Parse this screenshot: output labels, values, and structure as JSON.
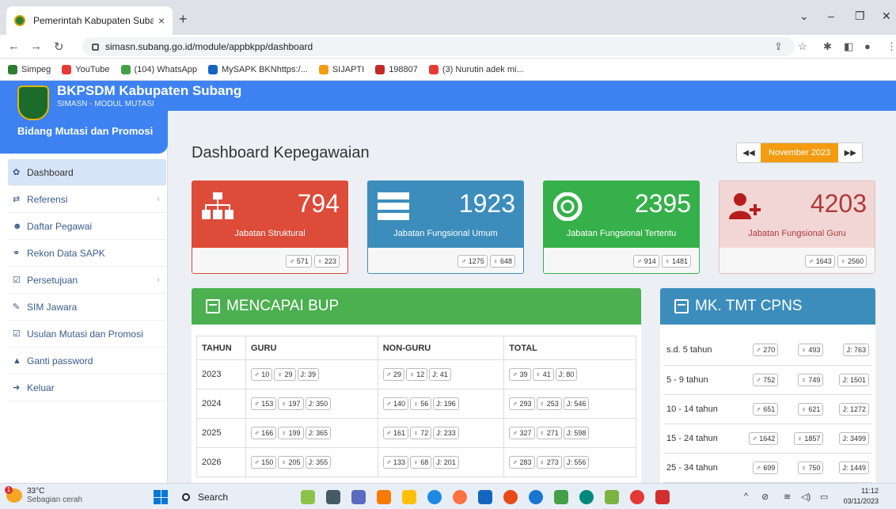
{
  "browser": {
    "tab_title": "Pemerintah Kabupaten Subang - ",
    "tab_close": "×",
    "new_tab": "+",
    "url": "simasn.subang.go.id/module/appbkpp/dashboard",
    "bookmarks": [
      {
        "label": "Simpeg",
        "color": "#2e7d32"
      },
      {
        "label": "YouTube",
        "color": "#e53935"
      },
      {
        "label": "(104) WhatsApp",
        "color": "#43a047"
      },
      {
        "label": "MySAPK BKNhttps:/...",
        "color": "#1565c0"
      },
      {
        "label": "SIJAPTI",
        "color": "#f39c12"
      },
      {
        "label": "198807",
        "color": "#c62828"
      },
      {
        "label": "(3) Nurutin adek mi...",
        "color": "#e53935"
      }
    ]
  },
  "app": {
    "brand_title": "BKPSDM Kabupaten Subang",
    "brand_subtitle": "SIMASN - MODUL MUTASI",
    "division": "Bidang Mutasi dan Promosi",
    "menu": [
      {
        "label": "Dashboard",
        "icon": "dashboard-icon",
        "glyph": "✿"
      },
      {
        "label": "Referensi",
        "icon": "exchange-icon",
        "glyph": "⇄"
      },
      {
        "label": "Daftar Pegawai",
        "icon": "users-icon",
        "glyph": "☻"
      },
      {
        "label": "Rekon Data SAPK",
        "icon": "link-icon",
        "glyph": "⚭"
      },
      {
        "label": "Persetujuan",
        "icon": "check-square-icon",
        "glyph": "☑"
      },
      {
        "label": "SIM Jawara",
        "icon": "wrench-icon",
        "glyph": "✎"
      },
      {
        "label": "Usulan Mutasi dan Promosi",
        "icon": "check-square-icon",
        "glyph": "☑"
      },
      {
        "label": "Ganti password",
        "icon": "lock-icon",
        "glyph": "▲"
      },
      {
        "label": "Keluar",
        "icon": "sign-out-icon",
        "glyph": "➜"
      }
    ],
    "page_title": "Dashboard Kepegawaian",
    "month": "November 2023",
    "prev": "◀◀",
    "next": "▶▶",
    "cards": [
      {
        "value": "794",
        "label": "Jabatan Struktural",
        "male": "♂ 571",
        "female": "♀ 223",
        "color": "#dd4b39",
        "icon": "sitemap-icon"
      },
      {
        "value": "1923",
        "label": "Jabatan Fungsional Umum",
        "male": "♂ 1275",
        "female": "♀ 648",
        "color": "#3c8dbc",
        "icon": "server-icon"
      },
      {
        "value": "2395",
        "label": "Jabatan Fungsional Tertentu",
        "male": "♂ 914",
        "female": "♀ 1481",
        "color": "#36b04a",
        "icon": "life-ring-icon"
      },
      {
        "value": "4203",
        "label": "Jabatan Fungsional Guru",
        "male": "♂ 1643",
        "female": "♀ 2560",
        "color": "#f2d6d6",
        "icon": "user-plus-icon"
      }
    ],
    "bup": {
      "title": "MENCAPAI BUP",
      "headers": [
        "TAHUN",
        "GURU",
        "NON-GURU",
        "TOTAL"
      ],
      "rows": [
        {
          "year": "2023",
          "guru": [
            "♂ 10",
            "♀ 29",
            "J: 39"
          ],
          "non": [
            "♂ 29",
            "♀ 12",
            "J: 41"
          ],
          "total": [
            "♂ 39",
            "♀ 41",
            "J: 80"
          ]
        },
        {
          "year": "2024",
          "guru": [
            "♂ 153",
            "♀ 197",
            "J: 350"
          ],
          "non": [
            "♂ 140",
            "♀ 56",
            "J: 196"
          ],
          "total": [
            "♂ 293",
            "♀ 253",
            "J: 546"
          ]
        },
        {
          "year": "2025",
          "guru": [
            "♂ 166",
            "♀ 199",
            "J: 365"
          ],
          "non": [
            "♂ 161",
            "♀ 72",
            "J: 233"
          ],
          "total": [
            "♂ 327",
            "♀ 271",
            "J: 598"
          ]
        },
        {
          "year": "2026",
          "guru": [
            "♂ 150",
            "♀ 205",
            "J: 355"
          ],
          "non": [
            "♂ 133",
            "♀ 68",
            "J: 201"
          ],
          "total": [
            "♂ 283",
            "♀ 273",
            "J: 556"
          ]
        }
      ]
    },
    "mk": {
      "title": "MK. TMT CPNS",
      "rows": [
        {
          "label": "s.d. 5 tahun",
          "male": "♂ 270",
          "female": "♀ 493",
          "total": "J: 763"
        },
        {
          "label": "5 - 9 tahun",
          "male": "♂ 752",
          "female": "♀ 749",
          "total": "J: 1501"
        },
        {
          "label": "10 - 14 tahun",
          "male": "♂ 651",
          "female": "♀ 621",
          "total": "J: 1272"
        },
        {
          "label": "15 - 24 tahun",
          "male": "♂ 1642",
          "female": "♀ 1857",
          "total": "J: 3499"
        },
        {
          "label": "25 - 34 tahun",
          "male": "♂ 699",
          "female": "♀ 750",
          "total": "J: 1449"
        }
      ]
    }
  },
  "taskbar": {
    "temp": "33°C",
    "weather": "Sebagian cerah",
    "weather_alert": "1",
    "search": "Search",
    "time": "11:12",
    "date": "03/11/2023"
  }
}
